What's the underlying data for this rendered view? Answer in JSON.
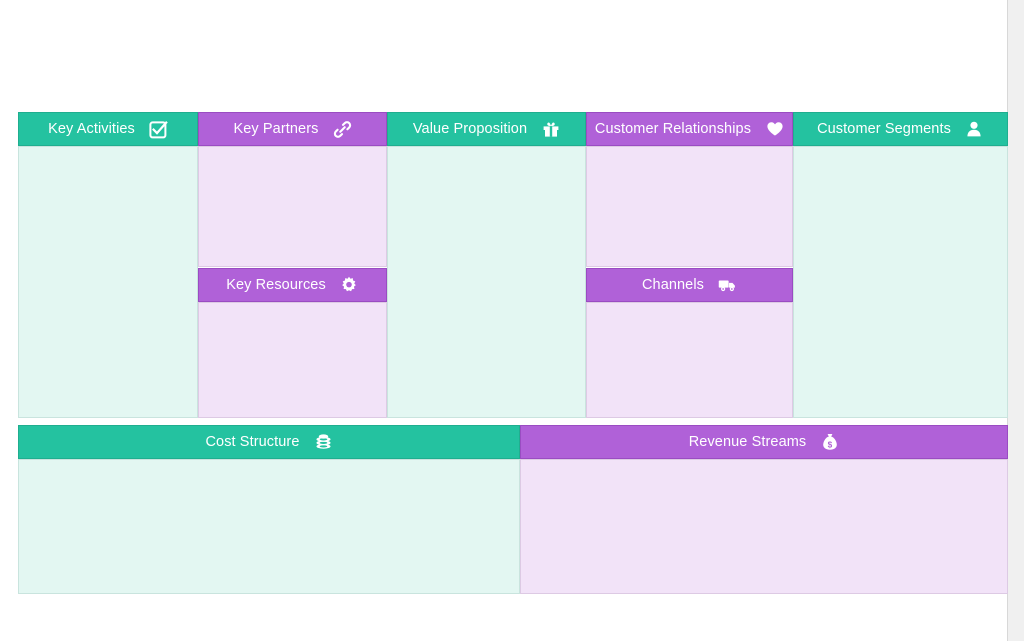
{
  "document": {
    "title": "Business Model Canvas",
    "background_color": "#f0f0f0",
    "page_color": "#ffffff"
  },
  "theme": {
    "teal_header": "#24c2a0",
    "teal_header_border": "#1fae8f",
    "teal_body": "#e3f7f2",
    "teal_body_border": "#c9e4de",
    "purple_header": "#b061d8",
    "purple_header_border": "#9a4cc2",
    "purple_body": "#f2e3f8",
    "purple_body_border": "#ddcae4",
    "header_text": "#ffffff"
  },
  "canvas": {
    "blocks": [
      {
        "id": "key-activities",
        "label": "Key Activities",
        "icon": "checkbox-checked-icon",
        "color": "teal",
        "content": ""
      },
      {
        "id": "key-partners",
        "label": "Key Partners",
        "icon": "link-icon",
        "color": "purple",
        "content": ""
      },
      {
        "id": "key-resources",
        "label": "Key Resources",
        "icon": "gear-icon",
        "color": "purple",
        "content": ""
      },
      {
        "id": "value-proposition",
        "label": "Value Proposition",
        "icon": "gift-icon",
        "color": "teal",
        "content": ""
      },
      {
        "id": "customer-relationships",
        "label": "Customer Relationships",
        "icon": "heart-icon",
        "color": "purple",
        "content": ""
      },
      {
        "id": "channels",
        "label": "Channels",
        "icon": "truck-icon",
        "color": "purple",
        "content": ""
      },
      {
        "id": "customer-segments",
        "label": "Customer Segments",
        "icon": "user-icon",
        "color": "teal",
        "content": ""
      },
      {
        "id": "cost-structure",
        "label": "Cost Structure",
        "icon": "coins-stack-icon",
        "color": "teal",
        "content": ""
      },
      {
        "id": "revenue-streams",
        "label": "Revenue Streams",
        "icon": "money-bag-icon",
        "color": "purple",
        "content": ""
      }
    ]
  }
}
